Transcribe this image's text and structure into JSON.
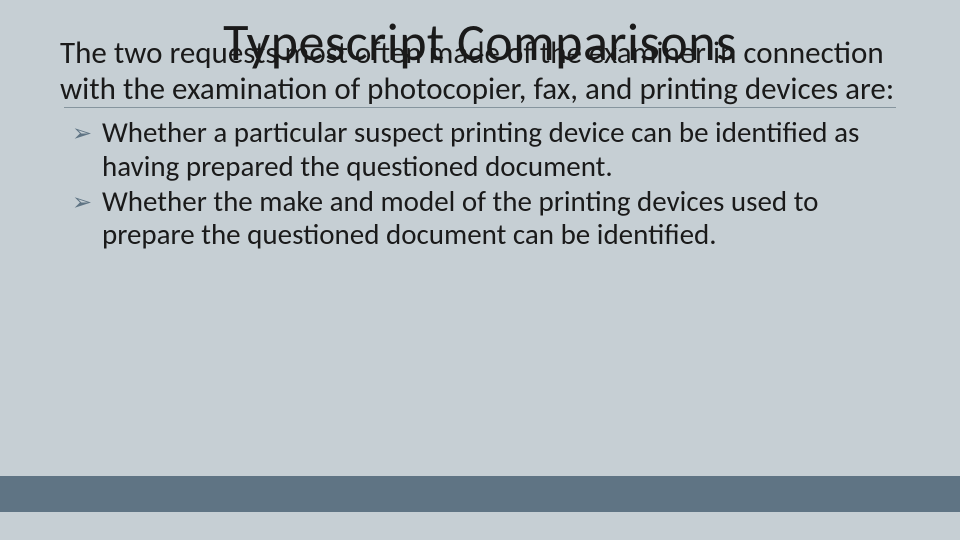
{
  "title": "Typescript Comparisons",
  "intro": "The two requests most often made of the examiner in connection with the examination of photocopier, fax, and printing devices are:",
  "bullets": [
    "Whether a particular suspect printing device can be identified as having prepared the questioned document.",
    "Whether the make and model of the printing devices used to prepare the questioned document can be identified."
  ],
  "colors": {
    "background": "#c6cfd4",
    "accent": "#5f7484",
    "rule": "#86959e"
  }
}
